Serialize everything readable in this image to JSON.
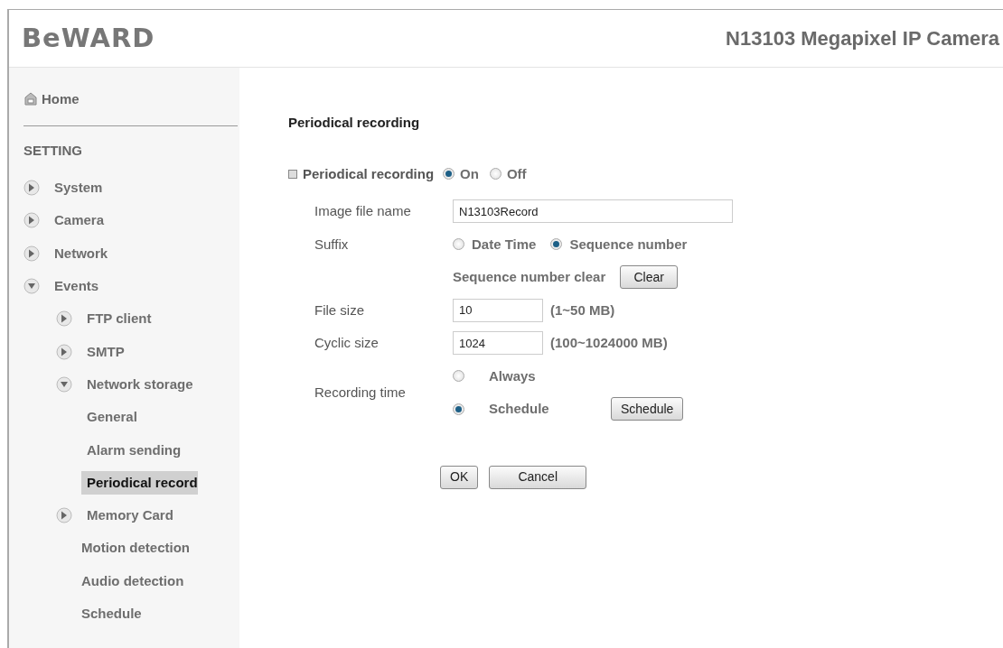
{
  "header": {
    "logo": "BeWARD",
    "title": "N13103 Megapixel IP Camera"
  },
  "sidebar": {
    "home": "Home",
    "section": "SETTING",
    "items": [
      {
        "label": "System",
        "kind": "folder",
        "expanded": false,
        "selected": false
      },
      {
        "label": "Camera",
        "kind": "folder",
        "expanded": false,
        "selected": false
      },
      {
        "label": "Network",
        "kind": "folder",
        "expanded": false,
        "selected": false
      },
      {
        "label": "Events",
        "kind": "folder",
        "expanded": true,
        "selected": false,
        "children": [
          {
            "label": "FTP client",
            "kind": "folder",
            "expanded": false,
            "selected": false
          },
          {
            "label": "SMTP",
            "kind": "folder",
            "expanded": false,
            "selected": false
          },
          {
            "label": "Network storage",
            "kind": "folder",
            "expanded": true,
            "selected": false,
            "children": [
              {
                "label": "General",
                "kind": "page",
                "selected": false
              },
              {
                "label": "Alarm sending",
                "kind": "page",
                "selected": false
              },
              {
                "label": "Periodical record",
                "kind": "page",
                "selected": true
              }
            ]
          },
          {
            "label": "Memory Card",
            "kind": "folder",
            "expanded": false,
            "selected": false
          },
          {
            "label": "Motion detection",
            "kind": "page",
            "selected": false
          },
          {
            "label": "Audio detection",
            "kind": "page",
            "selected": false
          },
          {
            "label": "Schedule",
            "kind": "page",
            "selected": false
          }
        ]
      }
    ]
  },
  "content": {
    "title": "Periodical recording",
    "toggle": {
      "label": "Periodical recording",
      "options": [
        {
          "label": "On",
          "selected": true
        },
        {
          "label": "Off",
          "selected": false
        }
      ]
    },
    "image_file_name": {
      "label": "Image file name",
      "value": "N13103Record"
    },
    "suffix": {
      "label": "Suffix",
      "options": [
        {
          "label": "Date Time",
          "selected": false
        },
        {
          "label": "Sequence number",
          "selected": true
        }
      ]
    },
    "sequence_clear": {
      "label": "Sequence number clear",
      "button": "Clear"
    },
    "file_size": {
      "label": "File size",
      "value": "10",
      "range": "(1~50 MB)"
    },
    "cyclic_size": {
      "label": "Cyclic size",
      "value": "1024",
      "range": "(100~1024000 MB)"
    },
    "recording_time": {
      "label": "Recording time",
      "options": [
        {
          "label": "Always",
          "selected": false
        },
        {
          "label": "Schedule",
          "selected": true,
          "button": "Schedule"
        }
      ]
    },
    "buttons": [
      "OK",
      "Cancel"
    ]
  }
}
